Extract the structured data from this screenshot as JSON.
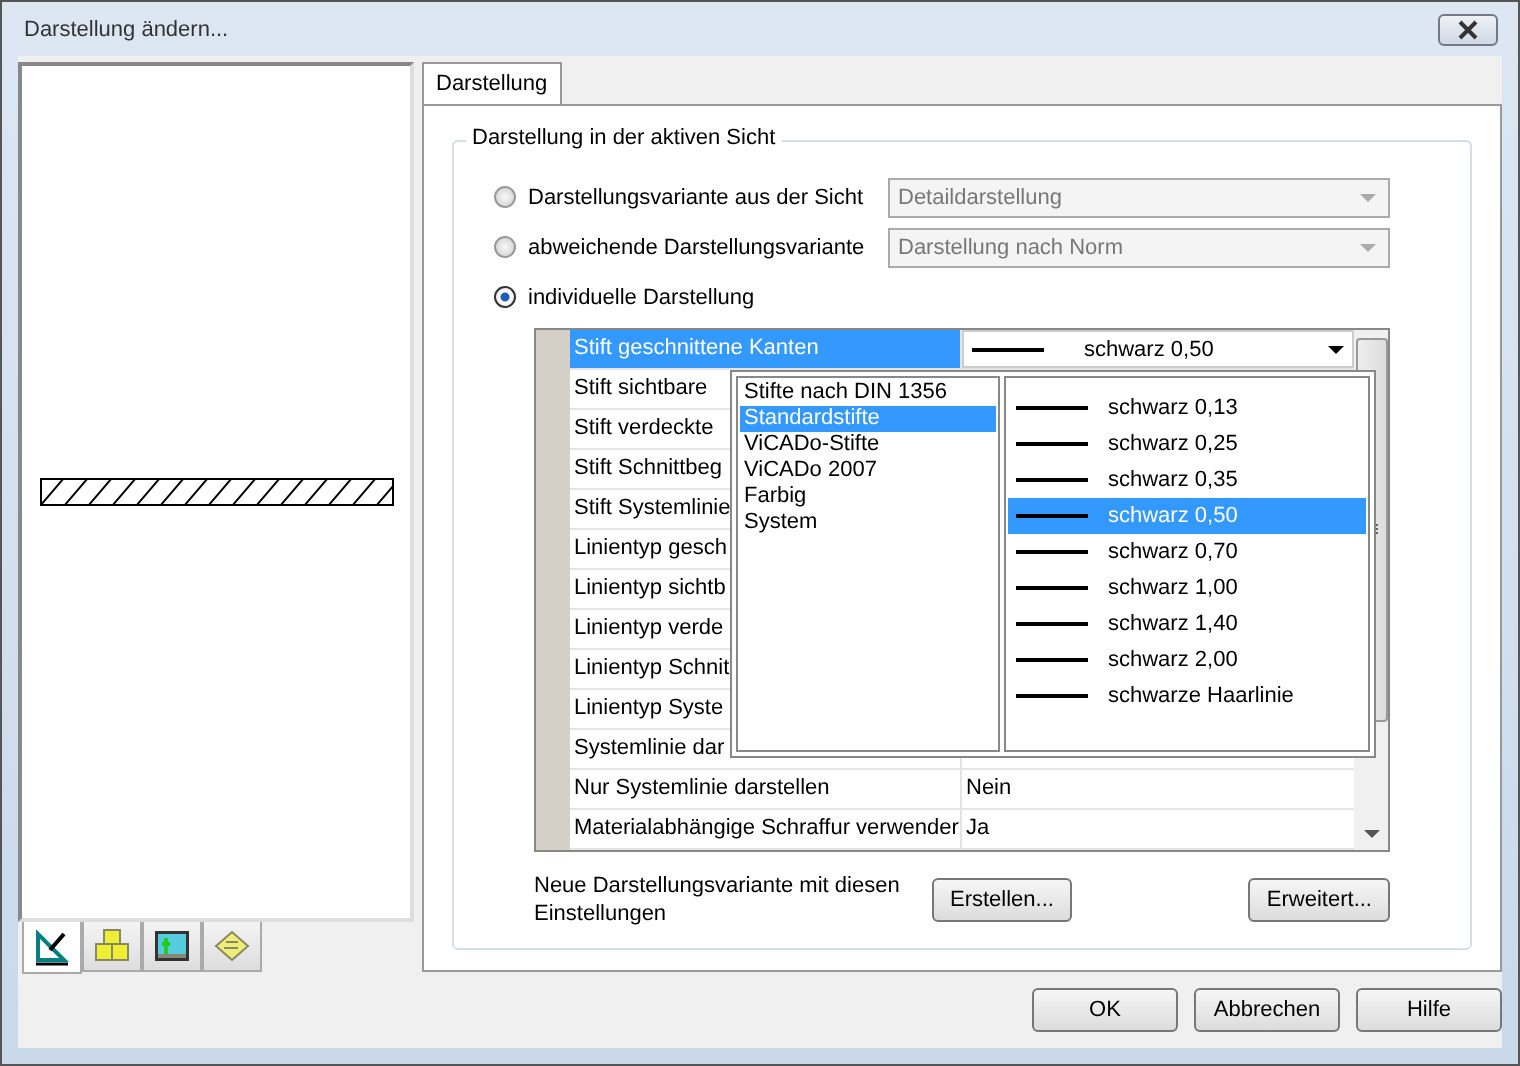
{
  "window": {
    "title": "Darstellung ändern..."
  },
  "left_tabs": [
    {
      "kind": "drafting",
      "selected": true
    },
    {
      "kind": "cubes",
      "selected": false
    },
    {
      "kind": "image",
      "selected": false
    },
    {
      "kind": "note",
      "selected": false
    }
  ],
  "tabs": [
    {
      "label": "Darstellung",
      "selected": true
    }
  ],
  "group": {
    "title": "Darstellung in der aktiven Sicht"
  },
  "options": [
    {
      "label": "Darstellungsvariante aus der Sicht",
      "selected": false,
      "combo": {
        "value": "Detaildarstellung",
        "disabled": true
      }
    },
    {
      "label": "abweichende Darstellungsvariante",
      "selected": false,
      "combo": {
        "value": "Darstellung nach Norm",
        "disabled": true
      }
    },
    {
      "label": "individuelle Darstellung",
      "selected": true
    }
  ],
  "grid": {
    "rows": [
      {
        "name": "Stift geschnittene Kanten",
        "value": "schwarz 0,50",
        "kind": "pen",
        "selected": true
      },
      {
        "name": "Stift sichtbare",
        "selected": false
      },
      {
        "name": "Stift verdeckte",
        "selected": false
      },
      {
        "name": "Stift Schnittbeg",
        "selected": false
      },
      {
        "name": "Stift Systemlinie",
        "selected": false
      },
      {
        "name": "Linientyp gesch",
        "selected": false
      },
      {
        "name": "Linientyp sichtb",
        "selected": false
      },
      {
        "name": "Linientyp verde",
        "selected": false
      },
      {
        "name": "Linientyp Schnit",
        "selected": false
      },
      {
        "name": "Linientyp Syste",
        "selected": false
      },
      {
        "name": "Systemlinie dar",
        "selected": false
      },
      {
        "name": "Nur Systemlinie darstellen",
        "value": "Nein",
        "kind": "text",
        "selected": false
      },
      {
        "name": "Materialabhängige Schraffur verwender",
        "value": "Ja",
        "kind": "text",
        "selected": false
      }
    ]
  },
  "dropdown": {
    "categories": [
      {
        "label": "Stifte nach DIN 1356",
        "selected": false
      },
      {
        "label": "Standardstifte",
        "selected": true
      },
      {
        "label": "ViCADo-Stifte",
        "selected": false
      },
      {
        "label": "ViCADo 2007",
        "selected": false
      },
      {
        "label": "Farbig",
        "selected": false
      },
      {
        "label": "System",
        "selected": false
      }
    ],
    "pens": [
      {
        "label": "schwarz 0,13",
        "selected": false
      },
      {
        "label": "schwarz 0,25",
        "selected": false
      },
      {
        "label": "schwarz 0,35",
        "selected": false
      },
      {
        "label": "schwarz 0,50",
        "selected": true
      },
      {
        "label": "schwarz 0,70",
        "selected": false
      },
      {
        "label": "schwarz 1,00",
        "selected": false
      },
      {
        "label": "schwarz 1,40",
        "selected": false
      },
      {
        "label": "schwarz 2,00",
        "selected": false
      },
      {
        "label": "schwarze Haarlinie",
        "selected": false
      }
    ]
  },
  "footer": {
    "text": "Neue Darstellungsvariante mit diesen Einstellungen",
    "create_button": "Erstellen...",
    "advanced_button": "Erweitert..."
  },
  "buttons": [
    "OK",
    "Abbrechen",
    "Hilfe"
  ]
}
